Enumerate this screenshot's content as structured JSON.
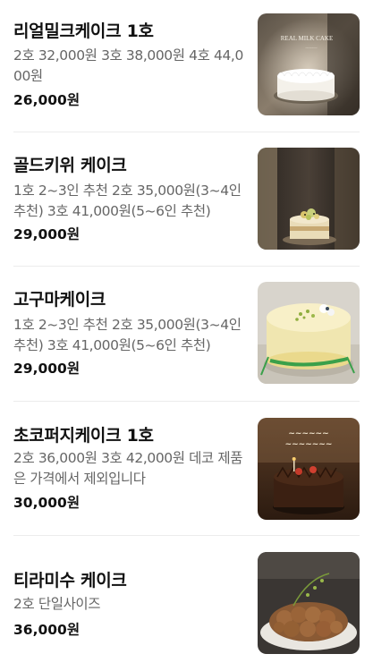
{
  "menu": {
    "items": [
      {
        "name": "리얼밀크케이크 1호",
        "description": "2호 32,000원 3호 38,000원 4호 44,000원",
        "price": "26,000원",
        "photo_icon": "milk-cake-photo",
        "photo_text": "REAL MILK CAKE"
      },
      {
        "name": "골드키위 케이크",
        "description": "1호 2~3인 추천 2호 35,000원(3~4인 추천) 3호 41,000원(5~6인 추천)",
        "price": "29,000원",
        "photo_icon": "gold-kiwi-cake-photo"
      },
      {
        "name": "고구마케이크",
        "description": "1호 2~3인 추천 2호 35,000원(3~4인 추천) 3호 41,000원(5~6인 추천)",
        "price": "29,000원",
        "photo_icon": "sweet-potato-cake-photo"
      },
      {
        "name": "초코퍼지케이크 1호",
        "description": "2호 36,000원 3호 42,000원 데코 제품은 가격에서 제외입니다",
        "price": "30,000원",
        "photo_icon": "choco-fudge-cake-photo"
      },
      {
        "name": "티라미수 케이크",
        "description": "2호 단일사이즈",
        "price": "36,000원",
        "photo_icon": "tiramisu-cake-photo"
      }
    ]
  }
}
